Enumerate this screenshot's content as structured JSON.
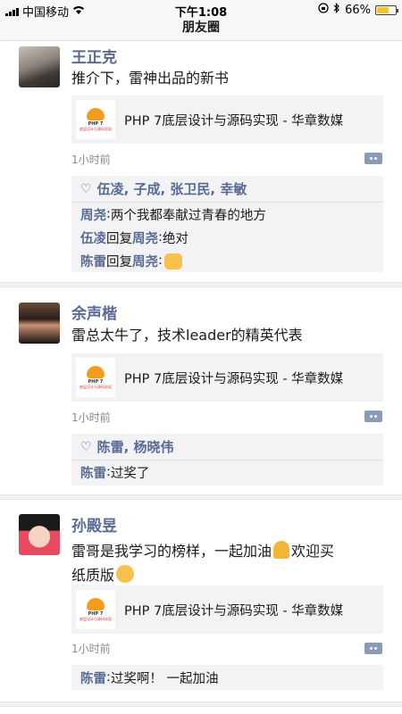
{
  "status_bar": {
    "carrier": "中国移动",
    "time": "下午1:08",
    "battery": "66%",
    "battery_level": 0.66
  },
  "nav": {
    "title": "朋友圈"
  },
  "posts": [
    {
      "name": "王正克",
      "text": "推介下，雷神出品的新书",
      "card_title": "PHP 7底层设计与源码实现 - 华章数媒",
      "time": "1小时前",
      "likes": "伍凌, 子成, 张卫民, 幸敏",
      "comments": [
        {
          "who": "周尧",
          "reply_to": "",
          "text": "两个我都奉献过青春的地方"
        },
        {
          "who": "伍凌",
          "reply_to": "周尧",
          "text": "绝对"
        },
        {
          "who": "陈雷",
          "reply_to": "周尧",
          "text": ""
        }
      ]
    },
    {
      "name": "余声楷",
      "text": "雷总太牛了，技术leader的精英代表",
      "card_title": "PHP 7底层设计与源码实现 - 华章数媒",
      "time": "1小时前",
      "likes": "陈雷, 杨晓伟",
      "comments": [
        {
          "who": "陈雷",
          "text": "过奖了"
        }
      ]
    },
    {
      "name": "孙殿昱",
      "text_a": "雷哥是我学习的榜样，一起加油",
      "text_b": "欢迎买",
      "text_c": "纸质版",
      "card_title": "PHP 7底层设计与源码实现 - 华章数媒",
      "time": "1小时前",
      "comments": [
        {
          "who": "陈雷",
          "text": "过奖啊！ 一起加油"
        }
      ]
    }
  ],
  "book_cover": {
    "line1": "PHP 7",
    "line2": "底层设计与源码实现"
  },
  "labels": {
    "reply": "回复",
    "colon": ": "
  }
}
